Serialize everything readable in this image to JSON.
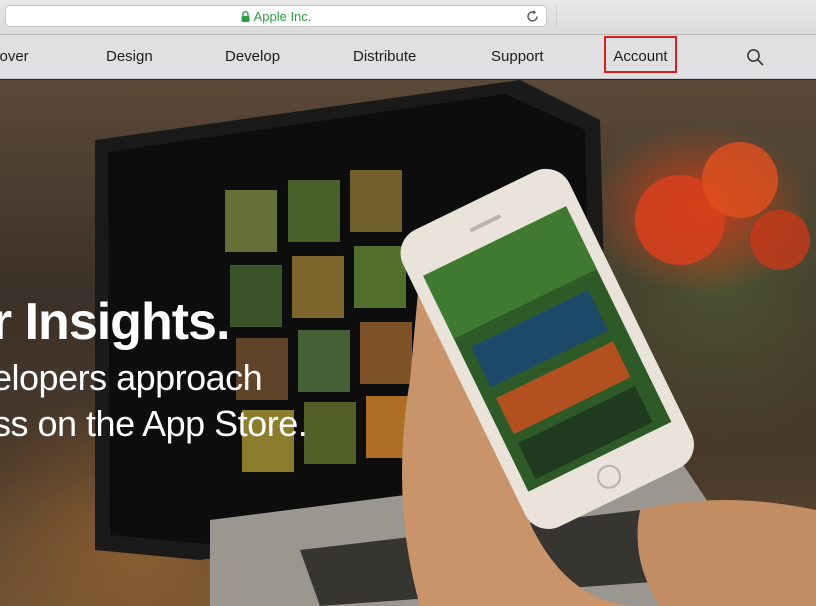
{
  "browser": {
    "address": "Apple Inc.",
    "lock_icon": "lock-icon",
    "reload_icon": "reload-icon"
  },
  "nav": {
    "items": [
      {
        "label": "cover"
      },
      {
        "label": "Design"
      },
      {
        "label": "Develop"
      },
      {
        "label": "Distribute"
      },
      {
        "label": "Support"
      },
      {
        "label": "Account"
      }
    ],
    "search_icon": "search-icon",
    "highlight_color": "#e01e1e"
  },
  "hero": {
    "headline": "er Insights.",
    "subline_1": "elopers approach",
    "subline_2": "ss on the App Store."
  }
}
